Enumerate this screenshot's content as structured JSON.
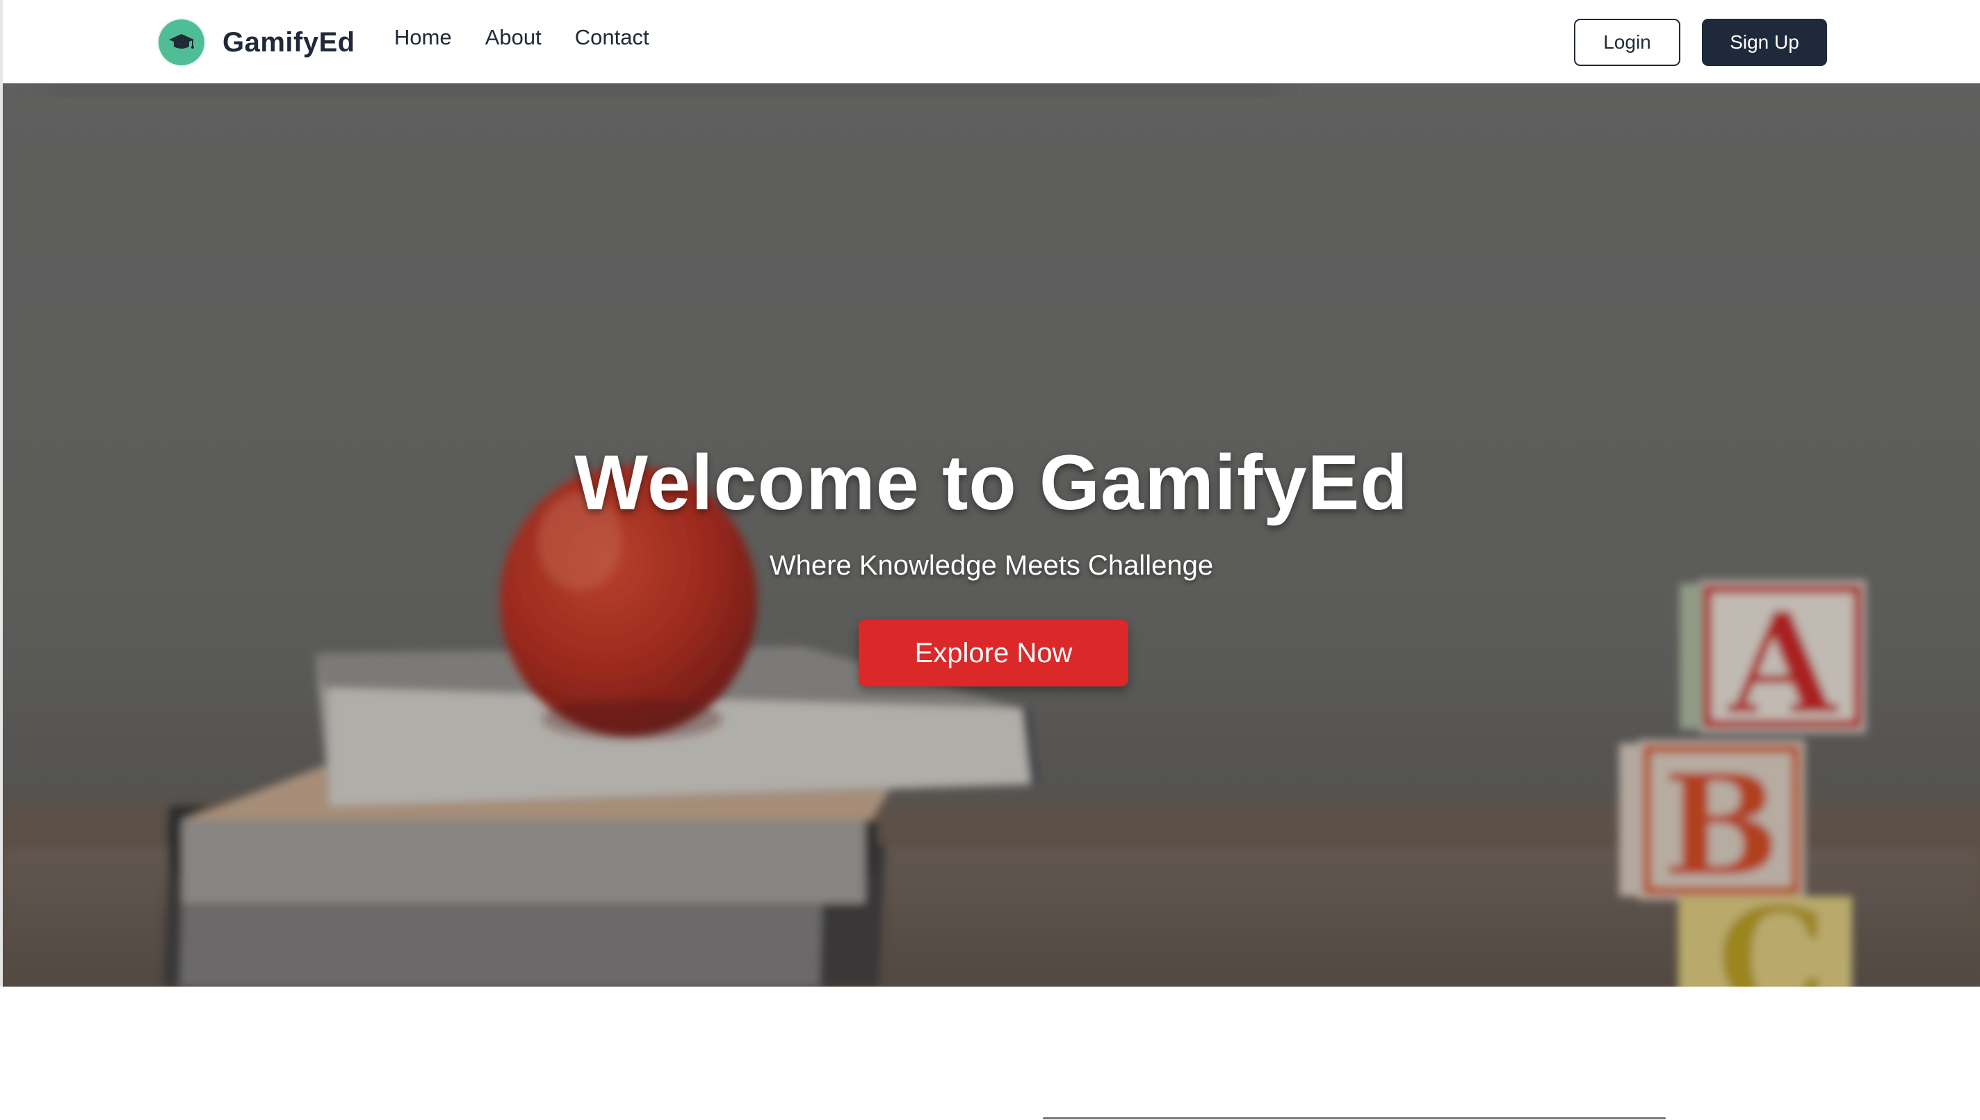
{
  "brand": {
    "name": "GamifyEd",
    "logo_icon": "graduation-cap-icon"
  },
  "nav": {
    "links": [
      "Home",
      "About",
      "Contact"
    ]
  },
  "auth": {
    "login_label": "Login",
    "signup_label": "Sign Up"
  },
  "hero": {
    "title": "Welcome to GamifyEd",
    "subtitle": "Where Knowledge Meets Challenge",
    "cta_label": "Explore Now",
    "blocks": [
      "A",
      "B",
      "C"
    ]
  },
  "colors": {
    "brand_green": "#4fbe96",
    "dark": "#1e293b",
    "cta_red": "#dc2828"
  }
}
